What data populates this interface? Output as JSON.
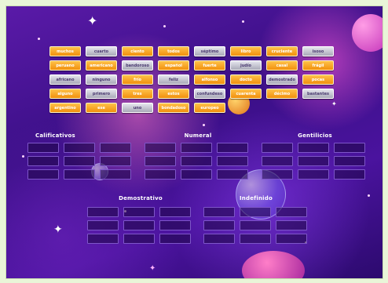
{
  "tiles": [
    {
      "label": "muchos",
      "style": "gold"
    },
    {
      "label": "cuarto",
      "style": "gray"
    },
    {
      "label": "ciento",
      "style": "gold"
    },
    {
      "label": "todos",
      "style": "gold"
    },
    {
      "label": "séptimo",
      "style": "gray"
    },
    {
      "label": "libro",
      "style": "gold"
    },
    {
      "label": "cruciente",
      "style": "gold"
    },
    {
      "label": "isoso",
      "style": "gray"
    },
    {
      "label": "peruano",
      "style": "gold"
    },
    {
      "label": "americano",
      "style": "gold"
    },
    {
      "label": "bandoroso",
      "style": "gray"
    },
    {
      "label": "español",
      "style": "gold"
    },
    {
      "label": "fuerte",
      "style": "gold"
    },
    {
      "label": "judío",
      "style": "gray"
    },
    {
      "label": "casal",
      "style": "gold"
    },
    {
      "label": "frágil",
      "style": "gold"
    },
    {
      "label": "africano",
      "style": "gray"
    },
    {
      "label": "ninguno",
      "style": "gray"
    },
    {
      "label": "frío",
      "style": "gold"
    },
    {
      "label": "feliz",
      "style": "gray"
    },
    {
      "label": "alfonso",
      "style": "gold"
    },
    {
      "label": "docto",
      "style": "gold"
    },
    {
      "label": "demostrado",
      "style": "gray"
    },
    {
      "label": "pocas",
      "style": "gold"
    },
    {
      "label": "alguno",
      "style": "gold"
    },
    {
      "label": "primero",
      "style": "gray"
    },
    {
      "label": "tres",
      "style": "gold"
    },
    {
      "label": "estos",
      "style": "gold"
    },
    {
      "label": "confundeso",
      "style": "gray"
    },
    {
      "label": "cuarenta",
      "style": "gold"
    },
    {
      "label": "décimo",
      "style": "gold"
    },
    {
      "label": "bastantes",
      "style": "gray"
    },
    {
      "label": "argentino",
      "style": "gold"
    },
    {
      "label": "ese",
      "style": "gold"
    },
    {
      "label": "uno",
      "style": "gray"
    },
    {
      "label": "bondadoso",
      "style": "gold"
    },
    {
      "label": "europeo",
      "style": "gold"
    }
  ],
  "categories": [
    {
      "title": "Calificativos"
    },
    {
      "title": "Numeral"
    },
    {
      "title": "Gentilicios"
    },
    {
      "title": "Demostrativo"
    },
    {
      "title": "Indefinido"
    }
  ],
  "colors": {
    "gold": "#f1900d",
    "gray": "#a9a9b8",
    "slot_border": "#7e56c9"
  }
}
